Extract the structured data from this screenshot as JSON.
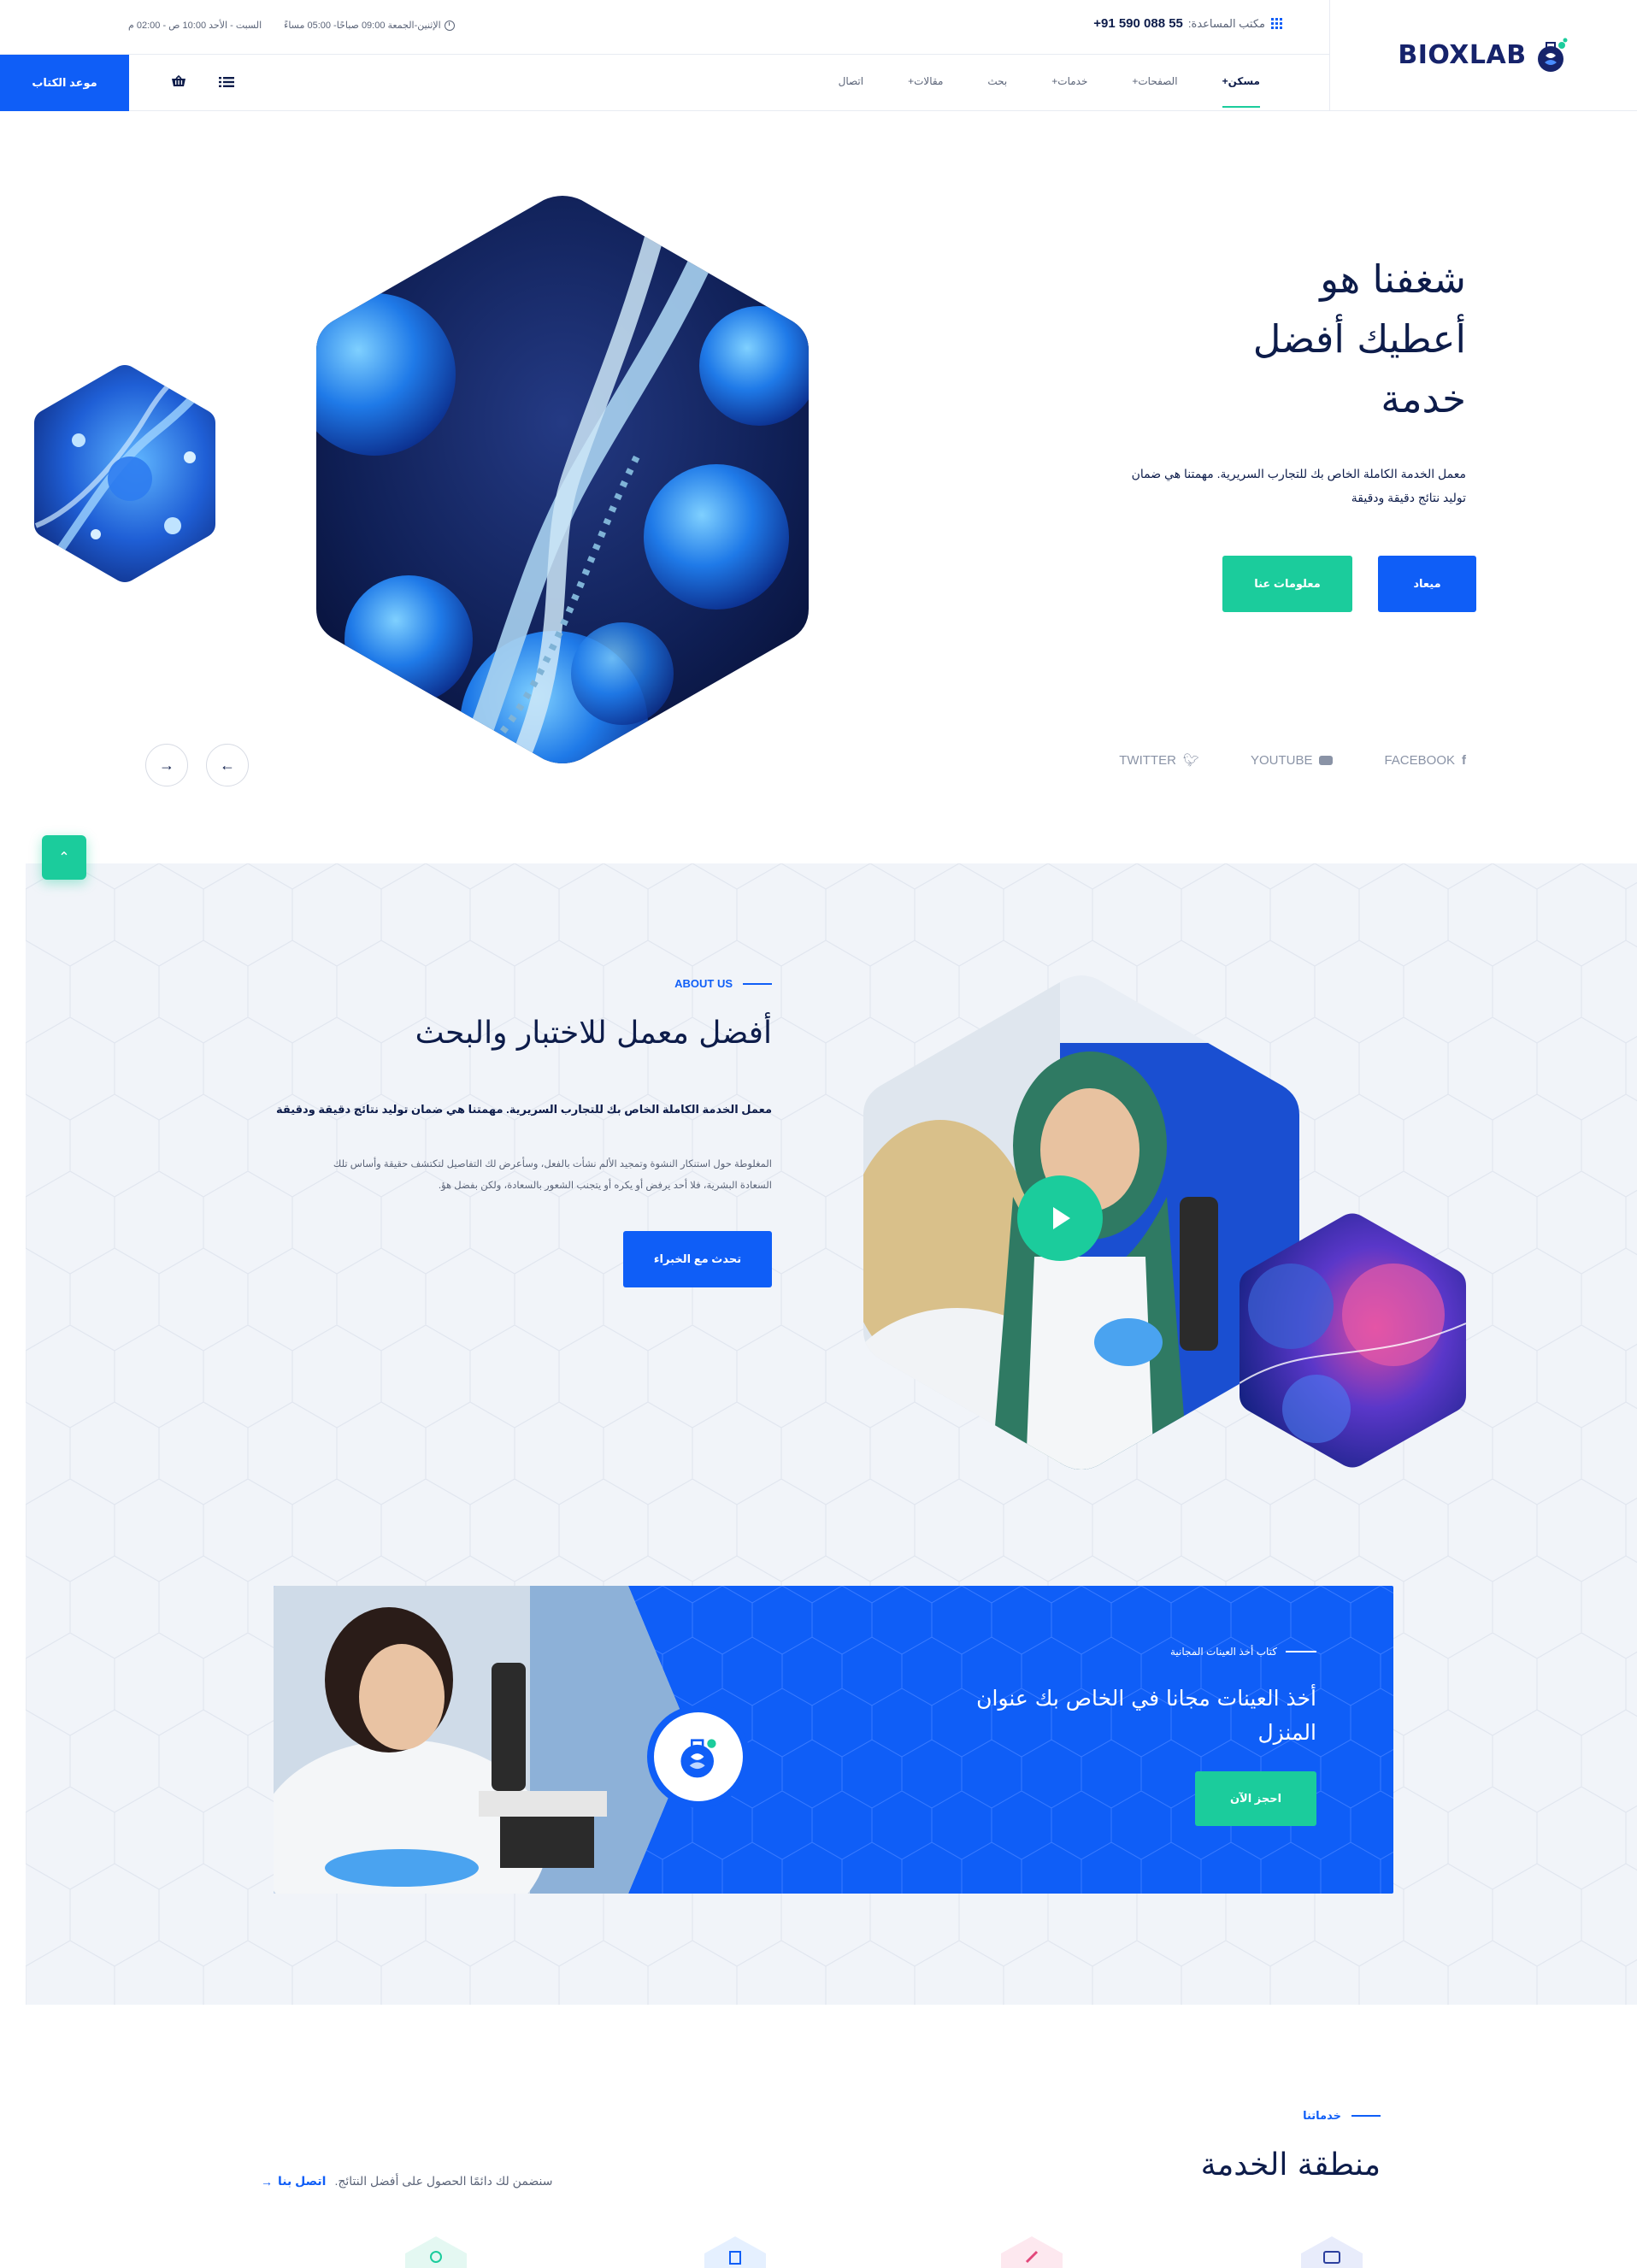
{
  "header": {
    "help_label": "مكتب المساعدة:",
    "help_number": "+91 590 088 55",
    "hours_weekday": "الإثنين-الجمعة 09:00 صباحًا- 05:00 مساءً",
    "hours_weekend": "السبت - الأحد 10:00 ص - 02:00 م",
    "logo": "BIOXLAB",
    "book_button": "موعد الكتاب",
    "nav": [
      {
        "label": "مسكن+",
        "active": true
      },
      {
        "label": "الصفحات+",
        "active": false
      },
      {
        "label": "خدمات+",
        "active": false
      },
      {
        "label": "بحث",
        "active": false
      },
      {
        "label": "مقالات+",
        "active": false
      },
      {
        "label": "اتصال",
        "active": false
      }
    ]
  },
  "hero": {
    "title_l1": "شغفنا هو",
    "title_l2": "أعطيك أفضل",
    "title_l3": "خدمة",
    "subtitle": "معمل الخدمة الكاملة الخاص بك للتجارب السريرية. مهمتنا هي ضمان توليد نتائج دقيقة ودقيقة",
    "btn_appointment": "ميعاد",
    "btn_about": "معلومات عنا",
    "social": [
      "FACEBOOK",
      "YOUTUBE",
      "TWITTER"
    ]
  },
  "about": {
    "kicker": "ABOUT US",
    "title": "أفضل معمل للاختبار والبحث",
    "strong": "معمل الخدمة الكاملة الخاص بك للتجارب السريرية. مهمتنا هي ضمان توليد نتائج دقيقة ودقيقة",
    "body": "المغلوطة حول استنكار النشوة وتمجيد الألم نشأت بالفعل، وسأعرض لك التفاصيل لتكتشف حقيقة وأساس تلك السعادة البشرية، فلا أحد يرفض أو يكره أو يتجنب الشعور بالسعادة، ولكن بفضل هؤ.",
    "button": "تحدث مع الخبراء"
  },
  "promo": {
    "kicker": "كتاب أخذ العينات المجانية",
    "title": "أخذ العينات مجانا في الخاص بك عنوان المنزل",
    "button": "احجز الآن"
  },
  "services": {
    "kicker": "خدماتنا",
    "title": "منطقة الخدمة",
    "tagline": "سنضمن لك دائمًا الحصول على أفضل النتائج.",
    "link": "اتصل بنا"
  },
  "colors": {
    "primary": "#0f5ef7",
    "accent": "#1bcc9c",
    "dark": "#0d1c4a",
    "section_bg": "#f1f4f9"
  }
}
